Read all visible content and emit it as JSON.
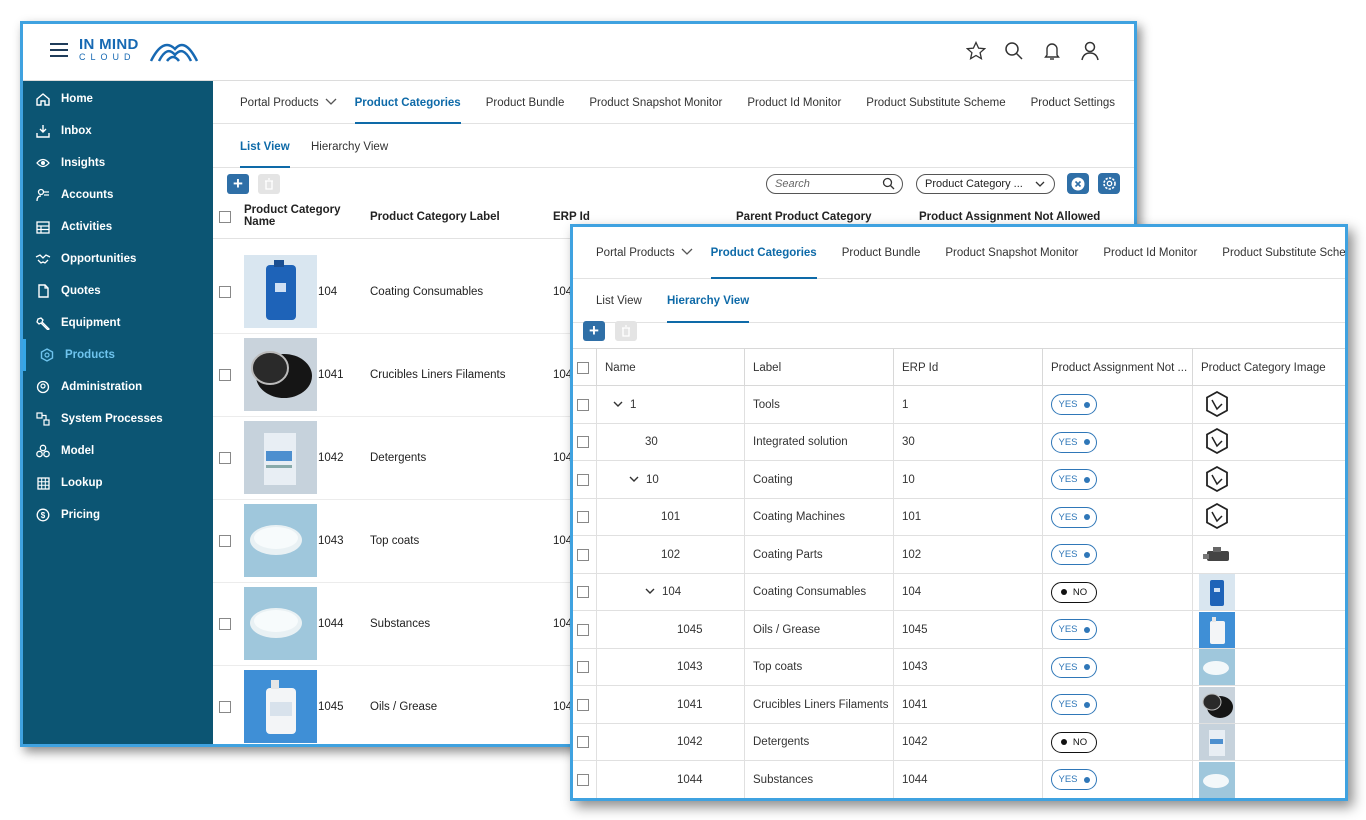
{
  "brand": {
    "line1": "IN MIND",
    "line2": "CLOUD"
  },
  "sidebar": {
    "items": [
      {
        "label": "Home",
        "icon": "home-icon"
      },
      {
        "label": "Inbox",
        "icon": "inbox-icon"
      },
      {
        "label": "Insights",
        "icon": "eye-icon"
      },
      {
        "label": "Accounts",
        "icon": "accounts-icon"
      },
      {
        "label": "Activities",
        "icon": "calendar-icon"
      },
      {
        "label": "Opportunities",
        "icon": "handshake-icon"
      },
      {
        "label": "Quotes",
        "icon": "quote-icon"
      },
      {
        "label": "Equipment",
        "icon": "wrench-icon"
      },
      {
        "label": "Products",
        "icon": "hexagon-icon",
        "active": true
      },
      {
        "label": "Administration",
        "icon": "admin-icon"
      },
      {
        "label": "System Processes",
        "icon": "process-icon"
      },
      {
        "label": "Model",
        "icon": "model-icon"
      },
      {
        "label": "Lookup",
        "icon": "grid-icon"
      },
      {
        "label": "Pricing",
        "icon": "dollar-icon"
      }
    ]
  },
  "back": {
    "tabs": [
      "Portal Products",
      "Product Categories",
      "Product Bundle",
      "Product Snapshot Monitor",
      "Product Id Monitor",
      "Product Substitute Scheme",
      "Product Settings"
    ],
    "subtabs": [
      "List View",
      "Hierarchy View"
    ],
    "search_placeholder": "Search",
    "select_value": "Product Category ...",
    "headers": {
      "name": "Product Category Name",
      "label": "Product Category Label",
      "erp": "ERP Id",
      "parent": "Parent Product Category",
      "assign": "Product Assignment Not Allowed"
    },
    "rows": [
      {
        "code": "104",
        "label": "Coating Consumables",
        "erp": "104"
      },
      {
        "code": "1041",
        "label": "Crucibles Liners Filaments",
        "erp": "104"
      },
      {
        "code": "1042",
        "label": "Detergents",
        "erp": "104"
      },
      {
        "code": "1043",
        "label": "Top coats",
        "erp": "104"
      },
      {
        "code": "1044",
        "label": "Substances",
        "erp": "104"
      },
      {
        "code": "1045",
        "label": "Oils / Grease",
        "erp": "104"
      }
    ]
  },
  "front": {
    "tabs": [
      "Portal Products",
      "Product Categories",
      "Product Bundle",
      "Product Snapshot Monitor",
      "Product Id Monitor",
      "Product Substitute Sche"
    ],
    "subtabs": [
      "List View",
      "Hierarchy View"
    ],
    "headers": {
      "name": "Name",
      "label": "Label",
      "erp": "ERP Id",
      "assign": "Product Assignment Not ...",
      "image": "Product Category Image"
    },
    "rows": [
      {
        "name": "1",
        "label": "Tools",
        "erp": "1",
        "assign": "YES"
      },
      {
        "name": "30",
        "label": "Integrated solution",
        "erp": "30",
        "assign": "YES"
      },
      {
        "name": "10",
        "label": "Coating",
        "erp": "10",
        "assign": "YES"
      },
      {
        "name": "101",
        "label": "Coating Machines",
        "erp": "101",
        "assign": "YES"
      },
      {
        "name": "102",
        "label": "Coating Parts",
        "erp": "102",
        "assign": "YES"
      },
      {
        "name": "104",
        "label": "Coating Consumables",
        "erp": "104",
        "assign": "NO"
      },
      {
        "name": "1045",
        "label": "Oils / Grease",
        "erp": "1045",
        "assign": "YES"
      },
      {
        "name": "1043",
        "label": "Top coats",
        "erp": "1043",
        "assign": "YES"
      },
      {
        "name": "1041",
        "label": "Crucibles Liners Filaments",
        "erp": "1041",
        "assign": "YES"
      },
      {
        "name": "1042",
        "label": "Detergents",
        "erp": "1042",
        "assign": "NO"
      },
      {
        "name": "1044",
        "label": "Substances",
        "erp": "1044",
        "assign": "YES"
      }
    ]
  }
}
